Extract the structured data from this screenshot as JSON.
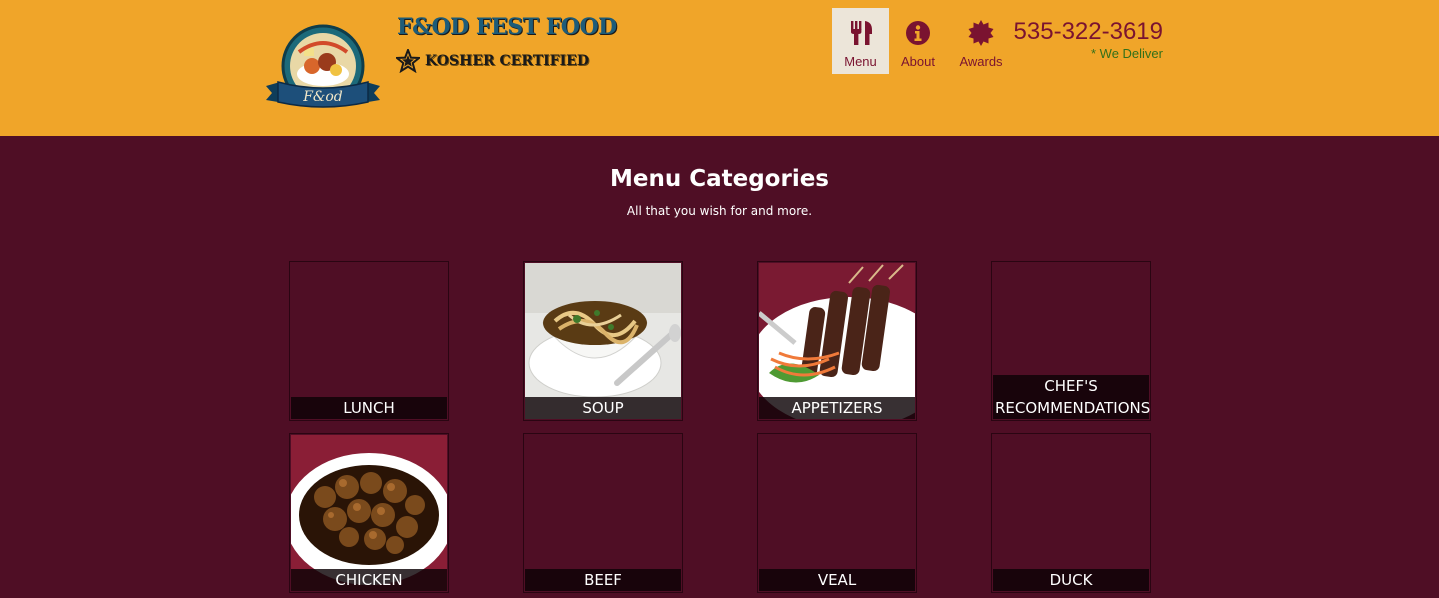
{
  "brand": {
    "name": "F&OD FEST FOOD",
    "badge": "KOSHER CERTIFIED",
    "logo_text": "F&od"
  },
  "nav": [
    {
      "label": "Menu",
      "icon": "utensils-icon",
      "active": true
    },
    {
      "label": "About",
      "icon": "info-circle-icon",
      "active": false
    },
    {
      "label": "Awards",
      "icon": "award-seal-icon",
      "active": false
    }
  ],
  "contact": {
    "phone": "535-322-3619",
    "delivery": "* We Deliver"
  },
  "section": {
    "title": "Menu Categories",
    "subtitle": "All that you wish for and more."
  },
  "categories": [
    {
      "label": "LUNCH",
      "has_image": false
    },
    {
      "label": "SOUP",
      "has_image": true,
      "image": "soup-photo"
    },
    {
      "label": "APPETIZERS",
      "has_image": true,
      "image": "skewers-photo"
    },
    {
      "label": "CHEF'S RECOMMENDATIONS",
      "has_image": false
    },
    {
      "label": "CHICKEN",
      "has_image": true,
      "image": "chicken-photo"
    },
    {
      "label": "BEEF",
      "has_image": false
    },
    {
      "label": "VEAL",
      "has_image": false
    },
    {
      "label": "DUCK",
      "has_image": false
    }
  ],
  "colors": {
    "header_bg": "#f0a529",
    "page_bg": "#4f0e25",
    "accent": "#7a1330",
    "delivery_green": "#33701a",
    "brand_blue": "#1e5c78"
  }
}
